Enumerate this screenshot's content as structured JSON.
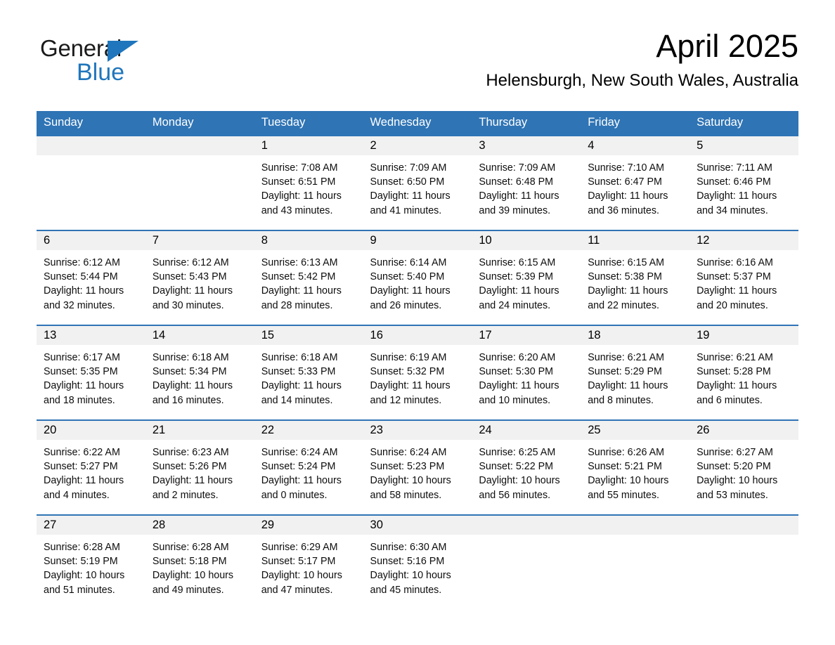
{
  "logo": {
    "word_one": "General",
    "word_two": "Blue",
    "triangle_color": "#1f76bc"
  },
  "header": {
    "month_title": "April 2025",
    "location": "Helensburgh, New South Wales, Australia"
  },
  "colors": {
    "header_blue": "#2f74b5",
    "daynum_band": "#f1f1f1",
    "text": "#000000"
  },
  "weekdays": [
    "Sunday",
    "Monday",
    "Tuesday",
    "Wednesday",
    "Thursday",
    "Friday",
    "Saturday"
  ],
  "weeks": [
    [
      {
        "day": "",
        "sunrise": "",
        "sunset": "",
        "daylight_line1": "",
        "daylight_line2": ""
      },
      {
        "day": "",
        "sunrise": "",
        "sunset": "",
        "daylight_line1": "",
        "daylight_line2": ""
      },
      {
        "day": "1",
        "sunrise": "Sunrise: 7:08 AM",
        "sunset": "Sunset: 6:51 PM",
        "daylight_line1": "Daylight: 11 hours",
        "daylight_line2": "and 43 minutes."
      },
      {
        "day": "2",
        "sunrise": "Sunrise: 7:09 AM",
        "sunset": "Sunset: 6:50 PM",
        "daylight_line1": "Daylight: 11 hours",
        "daylight_line2": "and 41 minutes."
      },
      {
        "day": "3",
        "sunrise": "Sunrise: 7:09 AM",
        "sunset": "Sunset: 6:48 PM",
        "daylight_line1": "Daylight: 11 hours",
        "daylight_line2": "and 39 minutes."
      },
      {
        "day": "4",
        "sunrise": "Sunrise: 7:10 AM",
        "sunset": "Sunset: 6:47 PM",
        "daylight_line1": "Daylight: 11 hours",
        "daylight_line2": "and 36 minutes."
      },
      {
        "day": "5",
        "sunrise": "Sunrise: 7:11 AM",
        "sunset": "Sunset: 6:46 PM",
        "daylight_line1": "Daylight: 11 hours",
        "daylight_line2": "and 34 minutes."
      }
    ],
    [
      {
        "day": "6",
        "sunrise": "Sunrise: 6:12 AM",
        "sunset": "Sunset: 5:44 PM",
        "daylight_line1": "Daylight: 11 hours",
        "daylight_line2": "and 32 minutes."
      },
      {
        "day": "7",
        "sunrise": "Sunrise: 6:12 AM",
        "sunset": "Sunset: 5:43 PM",
        "daylight_line1": "Daylight: 11 hours",
        "daylight_line2": "and 30 minutes."
      },
      {
        "day": "8",
        "sunrise": "Sunrise: 6:13 AM",
        "sunset": "Sunset: 5:42 PM",
        "daylight_line1": "Daylight: 11 hours",
        "daylight_line2": "and 28 minutes."
      },
      {
        "day": "9",
        "sunrise": "Sunrise: 6:14 AM",
        "sunset": "Sunset: 5:40 PM",
        "daylight_line1": "Daylight: 11 hours",
        "daylight_line2": "and 26 minutes."
      },
      {
        "day": "10",
        "sunrise": "Sunrise: 6:15 AM",
        "sunset": "Sunset: 5:39 PM",
        "daylight_line1": "Daylight: 11 hours",
        "daylight_line2": "and 24 minutes."
      },
      {
        "day": "11",
        "sunrise": "Sunrise: 6:15 AM",
        "sunset": "Sunset: 5:38 PM",
        "daylight_line1": "Daylight: 11 hours",
        "daylight_line2": "and 22 minutes."
      },
      {
        "day": "12",
        "sunrise": "Sunrise: 6:16 AM",
        "sunset": "Sunset: 5:37 PM",
        "daylight_line1": "Daylight: 11 hours",
        "daylight_line2": "and 20 minutes."
      }
    ],
    [
      {
        "day": "13",
        "sunrise": "Sunrise: 6:17 AM",
        "sunset": "Sunset: 5:35 PM",
        "daylight_line1": "Daylight: 11 hours",
        "daylight_line2": "and 18 minutes."
      },
      {
        "day": "14",
        "sunrise": "Sunrise: 6:18 AM",
        "sunset": "Sunset: 5:34 PM",
        "daylight_line1": "Daylight: 11 hours",
        "daylight_line2": "and 16 minutes."
      },
      {
        "day": "15",
        "sunrise": "Sunrise: 6:18 AM",
        "sunset": "Sunset: 5:33 PM",
        "daylight_line1": "Daylight: 11 hours",
        "daylight_line2": "and 14 minutes."
      },
      {
        "day": "16",
        "sunrise": "Sunrise: 6:19 AM",
        "sunset": "Sunset: 5:32 PM",
        "daylight_line1": "Daylight: 11 hours",
        "daylight_line2": "and 12 minutes."
      },
      {
        "day": "17",
        "sunrise": "Sunrise: 6:20 AM",
        "sunset": "Sunset: 5:30 PM",
        "daylight_line1": "Daylight: 11 hours",
        "daylight_line2": "and 10 minutes."
      },
      {
        "day": "18",
        "sunrise": "Sunrise: 6:21 AM",
        "sunset": "Sunset: 5:29 PM",
        "daylight_line1": "Daylight: 11 hours",
        "daylight_line2": "and 8 minutes."
      },
      {
        "day": "19",
        "sunrise": "Sunrise: 6:21 AM",
        "sunset": "Sunset: 5:28 PM",
        "daylight_line1": "Daylight: 11 hours",
        "daylight_line2": "and 6 minutes."
      }
    ],
    [
      {
        "day": "20",
        "sunrise": "Sunrise: 6:22 AM",
        "sunset": "Sunset: 5:27 PM",
        "daylight_line1": "Daylight: 11 hours",
        "daylight_line2": "and 4 minutes."
      },
      {
        "day": "21",
        "sunrise": "Sunrise: 6:23 AM",
        "sunset": "Sunset: 5:26 PM",
        "daylight_line1": "Daylight: 11 hours",
        "daylight_line2": "and 2 minutes."
      },
      {
        "day": "22",
        "sunrise": "Sunrise: 6:24 AM",
        "sunset": "Sunset: 5:24 PM",
        "daylight_line1": "Daylight: 11 hours",
        "daylight_line2": "and 0 minutes."
      },
      {
        "day": "23",
        "sunrise": "Sunrise: 6:24 AM",
        "sunset": "Sunset: 5:23 PM",
        "daylight_line1": "Daylight: 10 hours",
        "daylight_line2": "and 58 minutes."
      },
      {
        "day": "24",
        "sunrise": "Sunrise: 6:25 AM",
        "sunset": "Sunset: 5:22 PM",
        "daylight_line1": "Daylight: 10 hours",
        "daylight_line2": "and 56 minutes."
      },
      {
        "day": "25",
        "sunrise": "Sunrise: 6:26 AM",
        "sunset": "Sunset: 5:21 PM",
        "daylight_line1": "Daylight: 10 hours",
        "daylight_line2": "and 55 minutes."
      },
      {
        "day": "26",
        "sunrise": "Sunrise: 6:27 AM",
        "sunset": "Sunset: 5:20 PM",
        "daylight_line1": "Daylight: 10 hours",
        "daylight_line2": "and 53 minutes."
      }
    ],
    [
      {
        "day": "27",
        "sunrise": "Sunrise: 6:28 AM",
        "sunset": "Sunset: 5:19 PM",
        "daylight_line1": "Daylight: 10 hours",
        "daylight_line2": "and 51 minutes."
      },
      {
        "day": "28",
        "sunrise": "Sunrise: 6:28 AM",
        "sunset": "Sunset: 5:18 PM",
        "daylight_line1": "Daylight: 10 hours",
        "daylight_line2": "and 49 minutes."
      },
      {
        "day": "29",
        "sunrise": "Sunrise: 6:29 AM",
        "sunset": "Sunset: 5:17 PM",
        "daylight_line1": "Daylight: 10 hours",
        "daylight_line2": "and 47 minutes."
      },
      {
        "day": "30",
        "sunrise": "Sunrise: 6:30 AM",
        "sunset": "Sunset: 5:16 PM",
        "daylight_line1": "Daylight: 10 hours",
        "daylight_line2": "and 45 minutes."
      },
      {
        "day": "",
        "sunrise": "",
        "sunset": "",
        "daylight_line1": "",
        "daylight_line2": ""
      },
      {
        "day": "",
        "sunrise": "",
        "sunset": "",
        "daylight_line1": "",
        "daylight_line2": ""
      },
      {
        "day": "",
        "sunrise": "",
        "sunset": "",
        "daylight_line1": "",
        "daylight_line2": ""
      }
    ]
  ]
}
